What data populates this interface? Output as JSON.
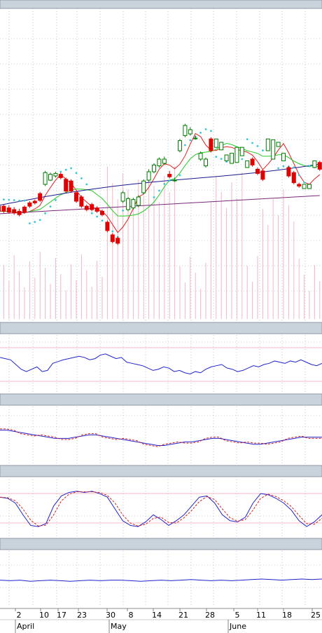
{
  "chart_data": {
    "type": "candlestick",
    "x_ticks": [
      {
        "label": "2",
        "i": 2
      },
      {
        "label": "10",
        "i": 8
      },
      {
        "label": "17",
        "i": 13
      },
      {
        "label": "23",
        "i": 17
      },
      {
        "label": "30",
        "i": 22
      },
      {
        "label": "8",
        "i": 28
      },
      {
        "label": "14",
        "i": 32
      },
      {
        "label": "21",
        "i": 37
      },
      {
        "label": "28",
        "i": 42
      },
      {
        "label": "5",
        "i": 47
      },
      {
        "label": "11",
        "i": 52
      },
      {
        "label": "18",
        "i": 57
      },
      {
        "label": "25",
        "i": 62
      }
    ],
    "months": [
      {
        "label": "April",
        "i": 2
      },
      {
        "label": "May",
        "i": 22
      },
      {
        "label": "June",
        "i": 47
      }
    ],
    "candles": [
      [
        134,
        128,
        136,
        126
      ],
      [
        134,
        128,
        136,
        126
      ],
      [
        132,
        127,
        135,
        125
      ],
      [
        130,
        126,
        133,
        124
      ],
      [
        128,
        124,
        131,
        122
      ],
      [
        133,
        127,
        135,
        125
      ],
      [
        138,
        134,
        140,
        132
      ],
      [
        140,
        138,
        142,
        136
      ],
      [
        149,
        141,
        151,
        139
      ],
      [
        160,
        174,
        176,
        158
      ],
      [
        165,
        172,
        174,
        164
      ],
      [
        170,
        173,
        175,
        168
      ],
      [
        172,
        168,
        174,
        166
      ],
      [
        166,
        152,
        168,
        150
      ],
      [
        164,
        152,
        166,
        150
      ],
      [
        150,
        140,
        152,
        138
      ],
      [
        145,
        134,
        147,
        132
      ],
      [
        134,
        130,
        136,
        128
      ],
      [
        136,
        130,
        138,
        128
      ],
      [
        132,
        128,
        134,
        126
      ],
      [
        128,
        124,
        130,
        122
      ],
      [
        115,
        105,
        117,
        103
      ],
      [
        100,
        92,
        102,
        90
      ],
      [
        96,
        90,
        98,
        88
      ],
      [
        140,
        150,
        152,
        138
      ],
      [
        130,
        143,
        145,
        128
      ],
      [
        132,
        142,
        144,
        130
      ],
      [
        135,
        145,
        147,
        133
      ],
      [
        150,
        164,
        166,
        148
      ],
      [
        165,
        175,
        178,
        163
      ],
      [
        175,
        183,
        185,
        173
      ],
      [
        182,
        190,
        192,
        180
      ],
      [
        185,
        190,
        193,
        183
      ],
      [
        172,
        169,
        176,
        167
      ],
      [
        165,
        165,
        168,
        163
      ],
      [
        200,
        212,
        214,
        198
      ],
      [
        218,
        230,
        232,
        216
      ],
      [
        220,
        225,
        228,
        218
      ],
      [
        215,
        215,
        218,
        213
      ],
      [
        190,
        197,
        199,
        188
      ],
      [
        182,
        190,
        192,
        180
      ],
      [
        214,
        200,
        216,
        198
      ],
      [
        204,
        214,
        206,
        212
      ],
      [
        201,
        210,
        203,
        208
      ],
      [
        188,
        195,
        190,
        194
      ],
      [
        185,
        197,
        188,
        195
      ],
      [
        186,
        204,
        189,
        202
      ],
      [
        194,
        204,
        196,
        202
      ],
      [
        180,
        188,
        183,
        186
      ],
      [
        190,
        183,
        192,
        181
      ],
      [
        178,
        173,
        180,
        171
      ],
      [
        176,
        166,
        178,
        164
      ],
      [
        200,
        214,
        202,
        212
      ],
      [
        190,
        213,
        192,
        211
      ],
      [
        205,
        210,
        207,
        208
      ],
      [
        188,
        197,
        190,
        195
      ],
      [
        180,
        170,
        182,
        168
      ],
      [
        174,
        162,
        176,
        160
      ],
      [
        160,
        158,
        162,
        156
      ],
      [
        155,
        160,
        157,
        158
      ],
      [
        155,
        160,
        157,
        158
      ],
      [
        180,
        188,
        182,
        186
      ],
      [
        186,
        178,
        188,
        176
      ]
    ],
    "indicator_1": [
      62,
      60,
      58,
      50,
      42,
      38,
      42,
      46,
      38,
      40,
      52,
      55,
      58,
      60,
      62,
      64,
      62,
      58,
      60,
      66,
      68,
      64,
      60,
      62,
      54,
      52,
      50,
      48,
      44,
      40,
      42,
      46,
      44,
      38,
      40,
      36,
      34,
      38,
      36,
      42,
      46,
      48,
      50,
      44,
      42,
      38,
      40,
      44,
      48,
      46,
      50,
      52,
      56,
      54,
      52,
      56,
      54,
      58,
      54,
      50,
      48,
      52
    ],
    "indicator_2": [
      60,
      60,
      58,
      56,
      54,
      52,
      50,
      48,
      46,
      46,
      46,
      48,
      50,
      52,
      52,
      50,
      48,
      46,
      44,
      42,
      40,
      38,
      36,
      34,
      34,
      36,
      38,
      40,
      40,
      42,
      44,
      46,
      46,
      44,
      42,
      40,
      38,
      36,
      36,
      38,
      40,
      42,
      44,
      46,
      48,
      48,
      48,
      48
    ],
    "stochastic": [
      70,
      68,
      60,
      40,
      22,
      20,
      25,
      55,
      72,
      78,
      80,
      78,
      80,
      76,
      70,
      50,
      30,
      22,
      20,
      28,
      40,
      32,
      22,
      30,
      40,
      55,
      70,
      72,
      60,
      40,
      30,
      28,
      36,
      60,
      76,
      74,
      68,
      60,
      48,
      30,
      20,
      28,
      40
    ],
    "indicator_4": [
      48,
      47,
      48,
      46,
      47,
      48,
      47,
      46,
      47,
      48,
      47,
      48,
      48,
      47,
      46,
      47,
      48,
      47,
      48,
      49,
      48,
      47,
      48,
      47,
      48,
      49,
      50,
      49,
      48,
      49,
      50,
      49,
      50
    ]
  }
}
